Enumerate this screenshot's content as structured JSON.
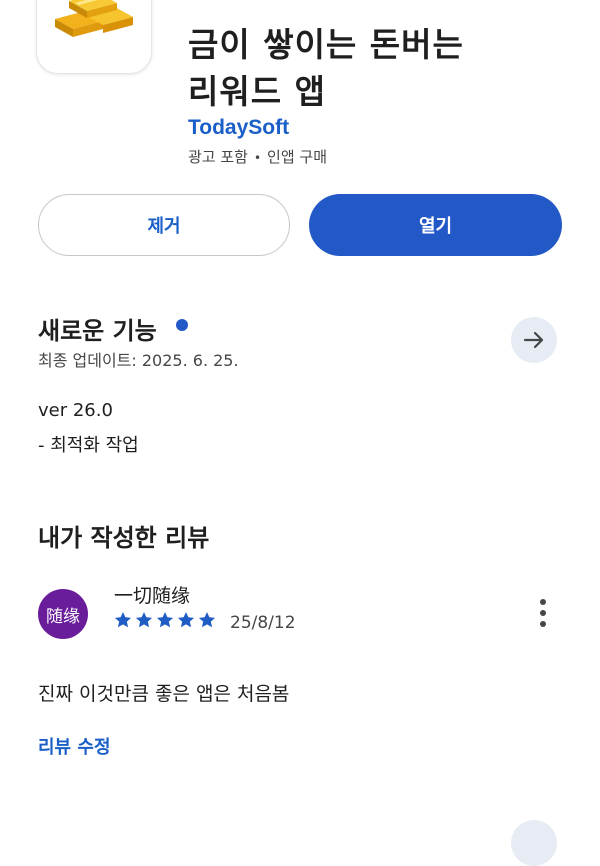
{
  "app": {
    "title_line1": "금이 쌓이는 돈버는",
    "title_line2": "리워드 앱",
    "developer": "TodaySoft",
    "meta_ads": "광고 포함",
    "meta_separator": "•",
    "meta_iap": "인앱 구매",
    "icon": "gold-bars-icon"
  },
  "actions": {
    "remove_label": "제거",
    "open_label": "열기"
  },
  "whats_new": {
    "title": "새로운 기능",
    "updated": "최종 업데이트: 2025. 6. 25.",
    "version": "ver 26.0",
    "notes": "- 최적화 작업",
    "arrow_icon": "arrow-right-icon"
  },
  "my_review": {
    "heading": "내가 작성한 리뷰",
    "avatar_text": "随缘",
    "reviewer_name": "一切随缘",
    "stars": 5,
    "date": "25/8/12",
    "text": "진짜 이것만큼 좋은 앱은 처음봄",
    "edit_label": "리뷰 수정"
  },
  "colors": {
    "accent": "#2359c7",
    "link": "#1a5fc8",
    "avatar_bg": "#6a1d9a"
  }
}
